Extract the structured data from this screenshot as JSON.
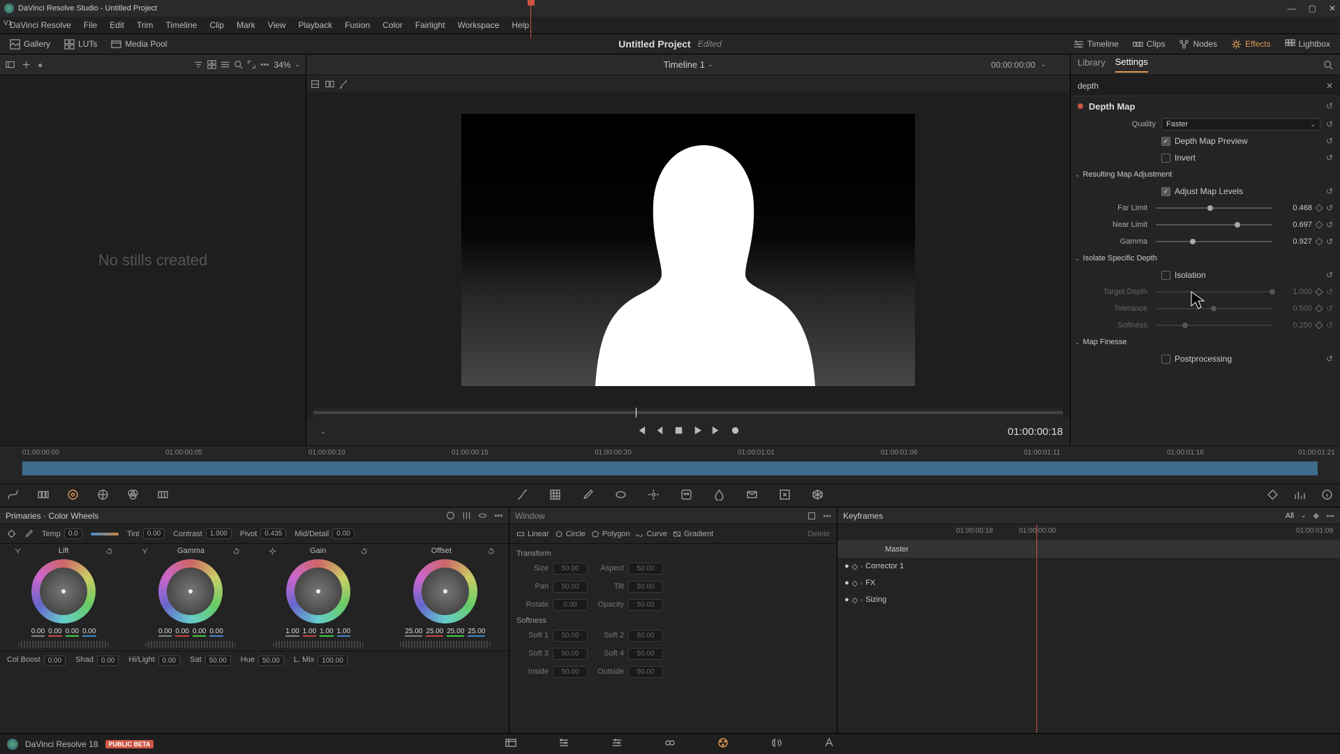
{
  "titlebar": {
    "title": "DaVinci Resolve Studio - Untitled Project"
  },
  "menu": {
    "items": [
      "DaVinci Resolve",
      "File",
      "Edit",
      "Trim",
      "Timeline",
      "Clip",
      "Mark",
      "View",
      "Playback",
      "Fusion",
      "Color",
      "Fairlight",
      "Workspace",
      "Help"
    ]
  },
  "toolbar": {
    "gallery": "Gallery",
    "luts": "LUTs",
    "mediapool": "Media Pool",
    "timeline": "Timeline",
    "clips": "Clips",
    "nodes": "Nodes",
    "effects": "Effects",
    "lightbox": "Lightbox"
  },
  "project": {
    "name": "Untitled Project",
    "edited": "Edited"
  },
  "leftpane": {
    "zoom": "34%",
    "msg": "No stills created"
  },
  "viewer": {
    "tname": "Timeline 1",
    "tc_top": "00:00:00:00",
    "tc_play": "01:00:00:18"
  },
  "rpanel": {
    "tabs": {
      "library": "Library",
      "settings": "Settings"
    },
    "search": "depth",
    "effect": {
      "name": "Depth Map"
    },
    "quality": {
      "label": "Quality",
      "value": "Faster"
    },
    "preview": "Depth Map Preview",
    "invert": "Invert",
    "map_adjust": "Resulting Map Adjustment",
    "adjust_levels": "Adjust Map Levels",
    "far": {
      "label": "Far Limit",
      "value": "0.468"
    },
    "near": {
      "label": "Near Limit",
      "value": "0.697"
    },
    "gamma": {
      "label": "Gamma",
      "value": "0.927"
    },
    "isolate": "Isolate Specific Depth",
    "isolation": "Isolation",
    "target": {
      "label": "Target Depth",
      "value": "1.000"
    },
    "tolerance": {
      "label": "Tolerance",
      "value": "0.500"
    },
    "softness": {
      "label": "Softness",
      "value": "0.250"
    },
    "finesse": "Map Finesse",
    "postprocessing": "Postprocessing"
  },
  "timeline_ruler": [
    "01:00:00:00",
    "01:00:00:05",
    "01:00:00:10",
    "01:00:00:15",
    "01:00:00:20",
    "01:00:01:01",
    "01:00:01:06",
    "01:00:01:11",
    "01:00:01:16",
    "01:00:01:21"
  ],
  "tracklabel": "V1",
  "primaries": {
    "title": "Primaries · Color Wheels",
    "temp": {
      "label": "Temp",
      "value": "0.0"
    },
    "tint": {
      "label": "Tint",
      "value": "0.00"
    },
    "contrast": {
      "label": "Contrast",
      "value": "1.000"
    },
    "pivot": {
      "label": "Pivot",
      "value": "0.435"
    },
    "middetail": {
      "label": "Mid/Detail",
      "value": "0.00"
    },
    "wheels": {
      "lift": {
        "name": "Lift",
        "vals": [
          "0.00",
          "0.00",
          "0.00",
          "0.00"
        ]
      },
      "gamma": {
        "name": "Gamma",
        "vals": [
          "0.00",
          "0.00",
          "0.00",
          "0.00"
        ]
      },
      "gain": {
        "name": "Gain",
        "vals": [
          "1.00",
          "1.00",
          "1.00",
          "1.00"
        ]
      },
      "offset": {
        "name": "Offset",
        "vals": [
          "25.00",
          "25.00",
          "25.00",
          "25.00"
        ]
      }
    },
    "footer": {
      "colboost": {
        "label": "Col Boost",
        "value": "0.00"
      },
      "shad": {
        "label": "Shad",
        "value": "0.00"
      },
      "hilight": {
        "label": "Hi/Light",
        "value": "0.00"
      },
      "sat": {
        "label": "Sat",
        "value": "50.00"
      },
      "hue": {
        "label": "Hue",
        "value": "50.00"
      },
      "lmix": {
        "label": "L. Mix",
        "value": "100.00"
      }
    }
  },
  "windowpane": {
    "title": "Window",
    "shapes": {
      "linear": "Linear",
      "circle": "Circle",
      "polygon": "Polygon",
      "curve": "Curve",
      "gradient": "Gradient",
      "delete": "Delete"
    },
    "transform": "Transform",
    "size": {
      "label": "Size",
      "value": "50.00"
    },
    "aspect": {
      "label": "Aspect",
      "value": "50.00"
    },
    "pan": {
      "label": "Pan",
      "value": "50.00"
    },
    "tilt": {
      "label": "Tilt",
      "value": "50.00"
    },
    "rotate": {
      "label": "Rotate",
      "value": "0.00"
    },
    "opacity": {
      "label": "Opacity",
      "value": "50.00"
    },
    "softness": "Softness",
    "soft1": {
      "label": "Soft 1",
      "value": "50.00"
    },
    "soft2": {
      "label": "Soft 2",
      "value": "50.00"
    },
    "soft3": {
      "label": "Soft 3",
      "value": "50.00"
    },
    "soft4": {
      "label": "Soft 4",
      "value": "50.00"
    },
    "inside": {
      "label": "Inside",
      "value": "50.00"
    },
    "outside": {
      "label": "Outside",
      "value": "50.00"
    }
  },
  "keyframes": {
    "title": "Keyframes",
    "all": "All",
    "tc": "01:00:00:18",
    "ticks": [
      "01:00:00:00",
      "01:00:01:09"
    ],
    "master": "Master",
    "rows": [
      "Corrector 1",
      "FX",
      "Sizing"
    ]
  },
  "appfoot": {
    "name": "DaVinci Resolve 18",
    "badge": "PUBLIC BETA"
  }
}
